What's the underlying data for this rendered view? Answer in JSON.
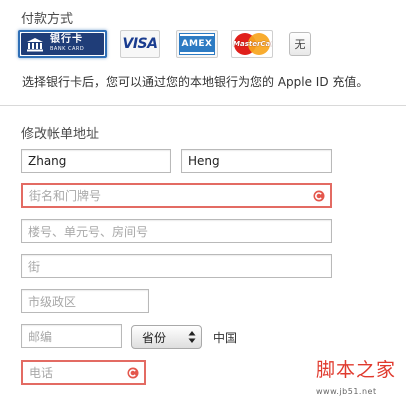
{
  "payment": {
    "title": "付款方式",
    "bank_card_label": "银行卡",
    "bank_card_sub": "BANK CARD",
    "visa_label": "VISA",
    "amex_label": "AMEX",
    "mastercard_label": "MasterCard",
    "none_label": "无",
    "info_text": "选择银行卡后，您可以通过您的本地银行为您的 Apple ID 充值。"
  },
  "billing": {
    "title": "修改帐单地址",
    "first_name": "Zhang",
    "last_name": "Heng",
    "street_placeholder": "街名和门牌号",
    "unit_placeholder": "楼号、单元号、房间号",
    "street2_placeholder": "街",
    "city_placeholder": "市级政区",
    "postal_placeholder": "邮编",
    "province_selected": "省份",
    "country": "中国",
    "phone_placeholder": "电话"
  },
  "watermark": {
    "main": "脚本之家",
    "sub": "www.jb51.net"
  },
  "colors": {
    "accent": "#2f6fb6",
    "error": "#e36b63",
    "bank_navy": "#1f3d78"
  },
  "icons": {
    "error": "error-circle-icon",
    "select_arrows": "up-down-arrows-icon",
    "bank": "bank-building-icon"
  }
}
